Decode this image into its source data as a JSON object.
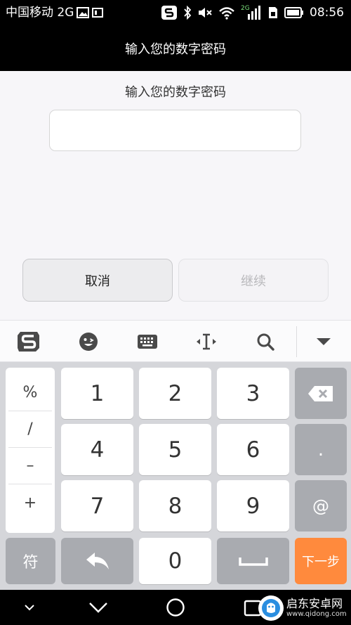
{
  "status_bar": {
    "carrier": "中国移动 2G",
    "time": "08:56",
    "signal_tag": "2G"
  },
  "title_bar": {
    "title": "输入您的数字密码"
  },
  "content": {
    "prompt": "输入您的数字密码",
    "pin_value": "",
    "cancel_label": "取消",
    "continue_label": "继续"
  },
  "ime_toolbar": {
    "icons": [
      "sogou-logo-icon",
      "emoji-icon",
      "keyboard-icon",
      "cursor-icon",
      "search-icon",
      "collapse-icon"
    ]
  },
  "keyboard": {
    "symbols": [
      "%",
      "/",
      "–",
      "+"
    ],
    "digits": [
      "1",
      "2",
      "3",
      "4",
      "5",
      "6",
      "7",
      "8",
      "9",
      "0"
    ],
    "dot": ".",
    "at": "@",
    "symbol_key": "符",
    "next_key": "下一步"
  },
  "watermark": {
    "name": "启东安卓网",
    "url": "www.qidong.com"
  },
  "colors": {
    "accent_next": "#ff8a3d",
    "bar_black": "#000000",
    "key_gray": "#a9abb0"
  }
}
